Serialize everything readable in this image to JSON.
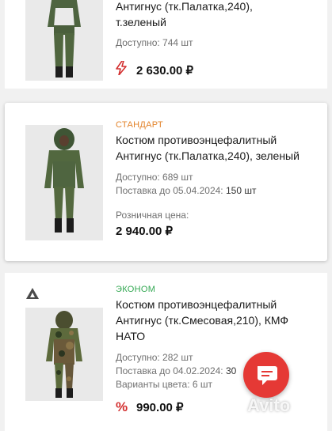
{
  "listings": [
    {
      "title_lines": [
        "Антигнус (тк.Палатка,240),",
        "т.зеленый"
      ],
      "available": "Доступно: 744 шт",
      "price": "2 630.00 ₽",
      "price_icon": "lightning-icon"
    },
    {
      "badge": "СТАНДАРТ",
      "title_lines": [
        "Костюм противоэнцефалитный",
        "Антигнус (тк.Палатка,240), зеленый"
      ],
      "available": "Доступно: 689 шт",
      "supply": "Поставка до 05.04.2024:",
      "supply_qty": "150 шт",
      "retail_label": "Розничная цена:",
      "price": "2 940.00 ₽"
    },
    {
      "badge": "ЭКОНОМ",
      "title_lines": [
        "Костюм противоэнцефалитный",
        "Антигнус (тк.Смесовая,210), КМФ",
        "НАТО"
      ],
      "available": "Доступно: 282 шт",
      "supply": "Поставка до 04.02.2024:",
      "supply_qty": "30",
      "variants": "Варианты цвета: 6 шт",
      "price": "990.00 ₽",
      "price_icon": "percent-icon"
    }
  ],
  "watermark": "Avito",
  "colors": {
    "accent_red": "#e53935",
    "standard": "#e3842c",
    "econom": "#33a852"
  }
}
